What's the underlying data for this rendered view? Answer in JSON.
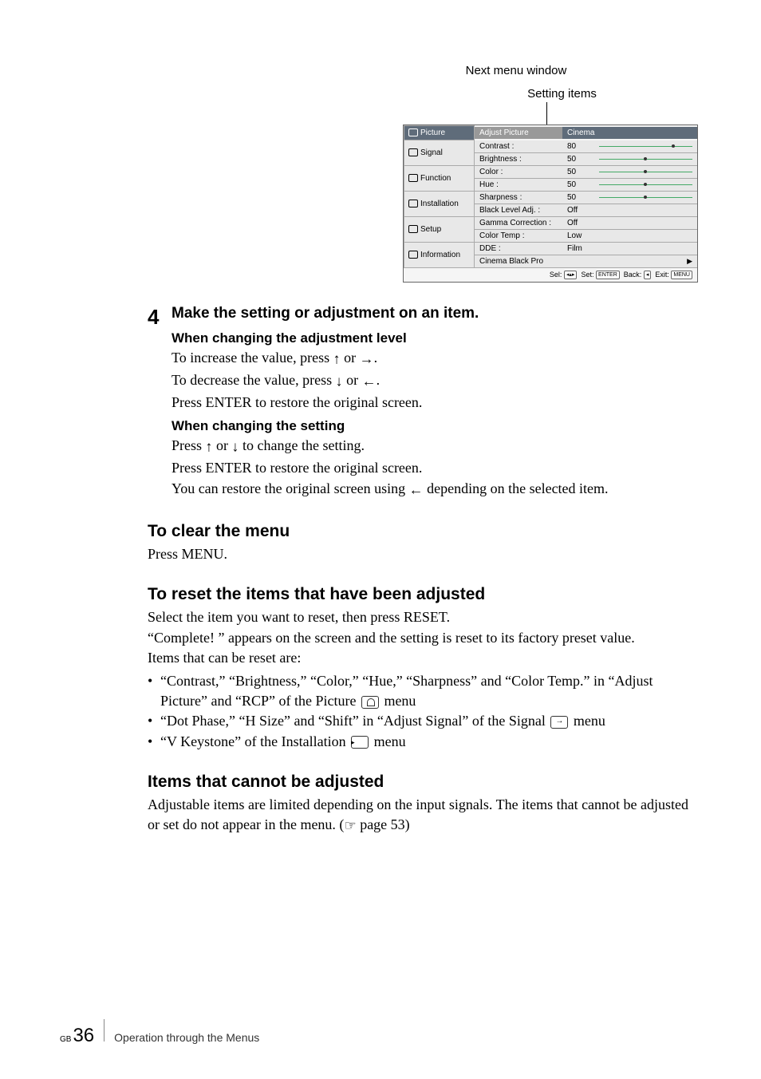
{
  "labels": {
    "nextWindow": "Next menu window",
    "settingItems": "Setting items"
  },
  "menu": {
    "sidebar": [
      {
        "label": "Picture",
        "active": true
      },
      {
        "label": "Signal",
        "active": false
      },
      {
        "label": "Function",
        "active": false
      },
      {
        "label": "Installation",
        "active": false
      },
      {
        "label": "Setup",
        "active": false
      },
      {
        "label": "Information",
        "active": false
      }
    ],
    "header": {
      "left": "Adjust Picture",
      "right": "Cinema"
    },
    "rows": [
      {
        "label": "Contrast :",
        "value": "80",
        "slider": "p80"
      },
      {
        "label": "Brightness :",
        "value": "50",
        "slider": "p50"
      },
      {
        "label": "Color :",
        "value": "50",
        "slider": "p50"
      },
      {
        "label": "Hue :",
        "value": "50",
        "slider": "p50"
      },
      {
        "label": "Sharpness :",
        "value": "50",
        "slider": "p50"
      },
      {
        "label": "Black Level Adj. :",
        "value": "Off",
        "slider": null
      },
      {
        "label": "Gamma Correction :",
        "value": "Off",
        "slider": null
      },
      {
        "label": "Color Temp :",
        "value": "Low",
        "slider": null
      },
      {
        "label": "DDE :",
        "value": "Film",
        "slider": null
      }
    ],
    "lastRow": "Cinema Black Pro",
    "hints": {
      "sel": "Sel:",
      "set": "Set:",
      "back": "Back:",
      "exit": "Exit:",
      "enter": "ENTER",
      "menu": "MENU"
    }
  },
  "step": {
    "num": "4",
    "title": "Make the setting or adjustment on an item.",
    "sub1": "When changing the adjustment level",
    "p1a": "To increase the value, press ",
    "p1b": " or ",
    "p1c": ".",
    "p2a": "To decrease the value, press ",
    "p2c": ".",
    "p3": "Press ENTER to restore the original screen.",
    "sub2": "When changing the setting",
    "p4a": "Press ",
    "p4c": " to change the setting.",
    "p5": "Press ENTER to restore the original screen.",
    "p6a": "You can restore the original screen using ",
    "p6b": " depending on the selected item."
  },
  "sections": {
    "clear": {
      "h": "To clear the menu",
      "p": "Press MENU."
    },
    "reset": {
      "h": "To reset the items that have been adjusted",
      "p1": "Select the item you want to reset, then press RESET.",
      "p2": "“Complete! ” appears on the screen and the setting is reset to its factory preset value.",
      "p3": "Items that can be reset are:",
      "b1a": "“Contrast,” “Brightness,” “Color,” “Hue,” “Sharpness” and “Color Temp.” in “Adjust Picture” and “RCP” of the Picture ",
      "b1b": "  menu",
      "b2a": "“Dot Phase,” “H Size” and “Shift” in “Adjust Signal” of the Signal ",
      "b2b": " menu",
      "b3a": "“V Keystone” of the Installation ",
      "b3b": "  menu"
    },
    "cannot": {
      "h": "Items that cannot be adjusted",
      "p1a": "Adjustable items are limited depending on the input signals. The items that cannot be adjusted or set do not appear in the menu. (",
      "p1b": " page 53)"
    }
  },
  "footer": {
    "gb": "GB",
    "page": "36",
    "text": "Operation through the Menus"
  }
}
